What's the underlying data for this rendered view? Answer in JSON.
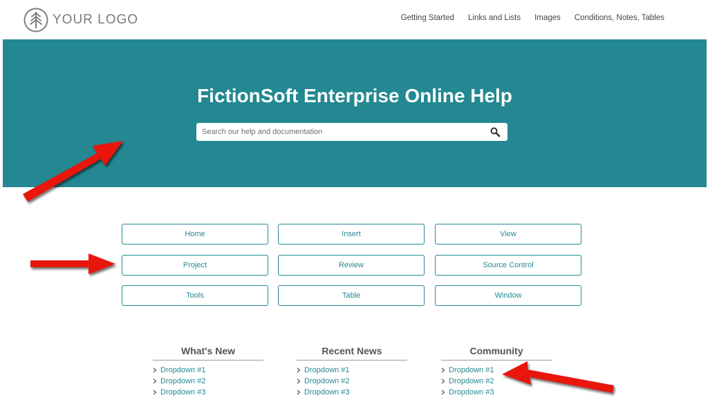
{
  "colors": {
    "accent": "#238891",
    "arrow": "#e8120c"
  },
  "header": {
    "logo_text": "YOUR LOGO",
    "logo_icon": "tree-icon",
    "nav": [
      "Getting Started",
      "Links and Lists",
      "Images",
      "Conditions, Notes, Tables"
    ]
  },
  "hero": {
    "title": "FictionSoft Enterprise Online Help",
    "search_placeholder": "Search our help and documentation",
    "search_icon": "search-icon"
  },
  "buttons": [
    "Home",
    "Insert",
    "View",
    "Project",
    "Review",
    "Source Control",
    "Tools",
    "Table",
    "Window"
  ],
  "columns": [
    {
      "title": "What's New",
      "items": [
        "Dropdown #1",
        "Dropdown #2",
        "Dropdown #3"
      ]
    },
    {
      "title": "Recent News",
      "items": [
        "Dropdown #1",
        "Dropdown #2",
        "Dropdown #3"
      ]
    },
    {
      "title": "Community",
      "items": [
        "Dropdown #1",
        "Dropdown #2",
        "Dropdown #3"
      ]
    }
  ],
  "annotations": [
    "red-arrow-icon",
    "red-arrow-icon",
    "red-arrow-icon"
  ]
}
